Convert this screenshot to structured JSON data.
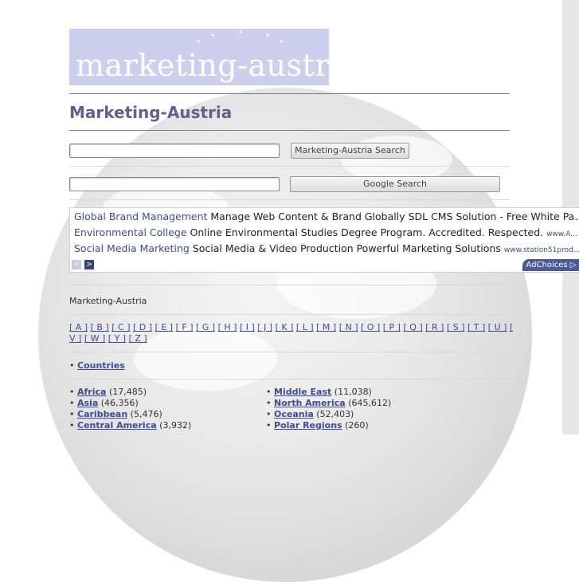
{
  "header": {
    "logo_text": "marketing-austria",
    "page_title": "Marketing-Austria"
  },
  "search": {
    "site_button": "Marketing-Austria Search",
    "google_button": "Google Search"
  },
  "ads": [
    {
      "title": "Global Brand Management",
      "text": "Manage Web Content & Brand Globally SDL CMS Solution - Free White Pa...",
      "url": ""
    },
    {
      "title": "Environmental College",
      "text": "Online Environmental Studies Degree Program. Accredited. Respected.",
      "url": "www.A..."
    },
    {
      "title": "Social Media Marketing",
      "text": "Social Media & Video Production Powerful Marketing Solutions",
      "url": "www.station51prod..."
    }
  ],
  "ad_nav": {
    "prev": "<",
    "next": ">"
  },
  "adchoices": "AdChoices ▷",
  "breadcrumb": "Marketing-Austria",
  "alphabet": [
    "[ A ]",
    "[ B ]",
    "[ C ]",
    "[ D ]",
    "[ E ]",
    "[ F ]",
    "[ G ]",
    "[ H ]",
    "[ I ]",
    "[ J ]",
    "[ K ]",
    "[ L ]",
    "[ M ]",
    "[ N ]",
    "[ O ]",
    "[ P ]",
    "[ Q ]",
    "[ R ]",
    "[ S ]",
    "[ T ]",
    "[ U ]",
    "[ V ]",
    "[ W ]",
    "[ Y ]",
    "[ Z ]"
  ],
  "countries_link": "Countries",
  "regions_left": [
    {
      "name": "Africa",
      "count": "(17,485)"
    },
    {
      "name": "Asia",
      "count": "(46,356)"
    },
    {
      "name": "Caribbean",
      "count": "(5,476)"
    },
    {
      "name": "Central America",
      "count": "(3,932)"
    }
  ],
  "regions_right": [
    {
      "name": "Middle East",
      "count": "(11,038)"
    },
    {
      "name": "North America",
      "count": "(645,612)"
    },
    {
      "name": "Oceania",
      "count": "(52,403)"
    },
    {
      "name": "Polar Regions",
      "count": "(260)"
    }
  ]
}
